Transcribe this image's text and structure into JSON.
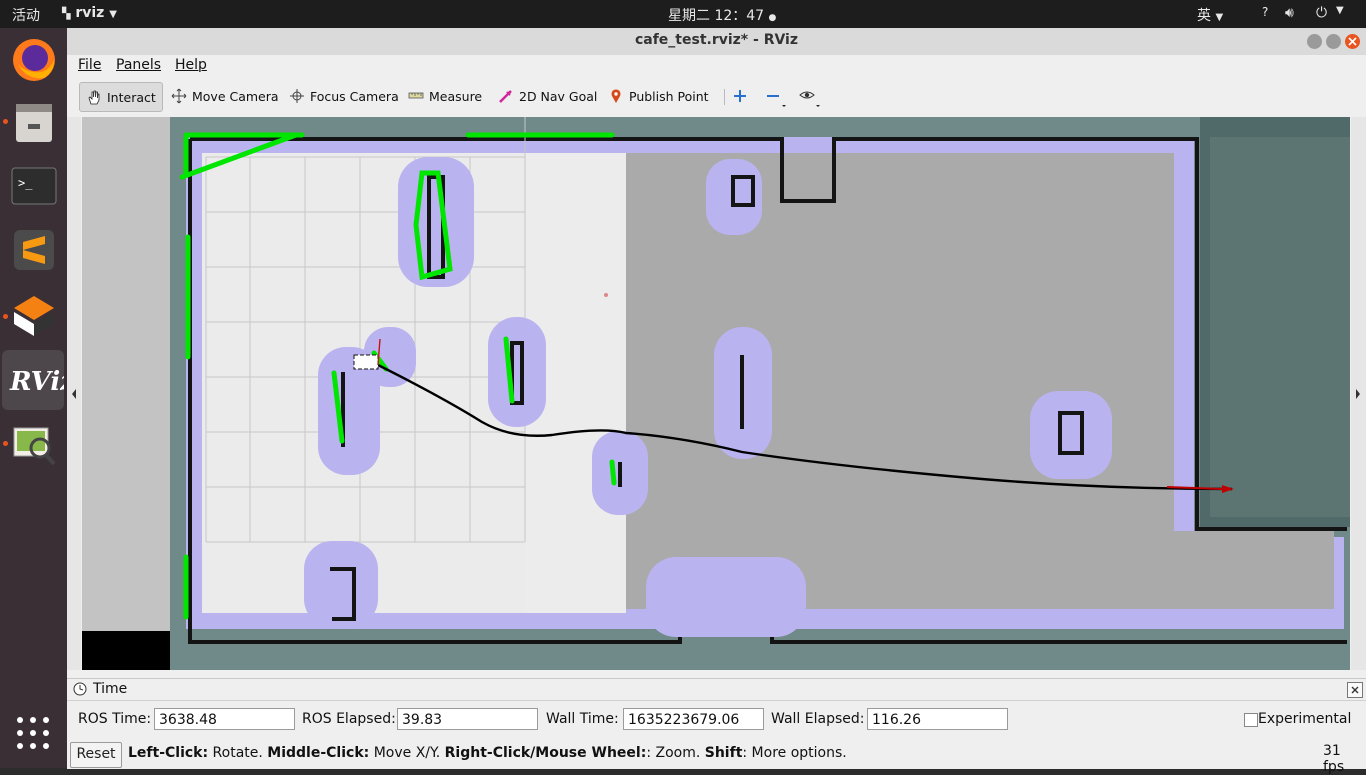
{
  "topbar": {
    "activities": "活动",
    "app_menu": "rviz",
    "clock": "星期二 12：47",
    "input_method": "英",
    "help_label": "?"
  },
  "window": {
    "title": "cafe_test.rviz* - RViz"
  },
  "menubar": {
    "items": [
      "File",
      "Panels",
      "Help"
    ]
  },
  "toolbar": {
    "tools": [
      {
        "label": "Interact",
        "icon": "hand-icon",
        "active": true
      },
      {
        "label": "Move Camera",
        "icon": "move-camera-icon",
        "active": false
      },
      {
        "label": "Focus Camera",
        "icon": "focus-camera-icon",
        "active": false
      },
      {
        "label": "Measure",
        "icon": "ruler-icon",
        "active": false
      },
      {
        "label": "2D Nav Goal",
        "icon": "nav-goal-arrow-icon",
        "active": false
      },
      {
        "label": "Publish Point",
        "icon": "map-pin-icon",
        "active": false
      }
    ],
    "extra_icons": [
      "plus-icon",
      "minus-icon",
      "eye-icon"
    ]
  },
  "time_panel": {
    "title": "Time",
    "ros_time_label": "ROS Time:",
    "ros_time_value": "3638.48",
    "ros_elapsed_label": "ROS Elapsed:",
    "ros_elapsed_value": "39.83",
    "wall_time_label": "Wall Time:",
    "wall_time_value": "1635223679.06",
    "wall_elapsed_label": "Wall Elapsed:",
    "wall_elapsed_value": "116.26",
    "experimental_label": "Experimental",
    "experimental_checked": false
  },
  "statusbar": {
    "reset_label": "Reset",
    "left_click": "Left-Click:",
    "left_click_desc": " Rotate. ",
    "middle_click": "Middle-Click:",
    "middle_click_desc": " Move X/Y. ",
    "right_click": "Right-Click/Mouse Wheel:",
    "right_click_desc": ": Zoom. ",
    "shift": "Shift",
    "shift_desc": ": More options.",
    "fps": "31 fps"
  },
  "colors": {
    "map_unknown": "#a9a9a9",
    "map_free": "#ebebeb",
    "inflation": "#b9b3ef",
    "obstacle": "#111111",
    "laser": "#00ee00",
    "path": "#000000",
    "goal": "#cc0000"
  }
}
